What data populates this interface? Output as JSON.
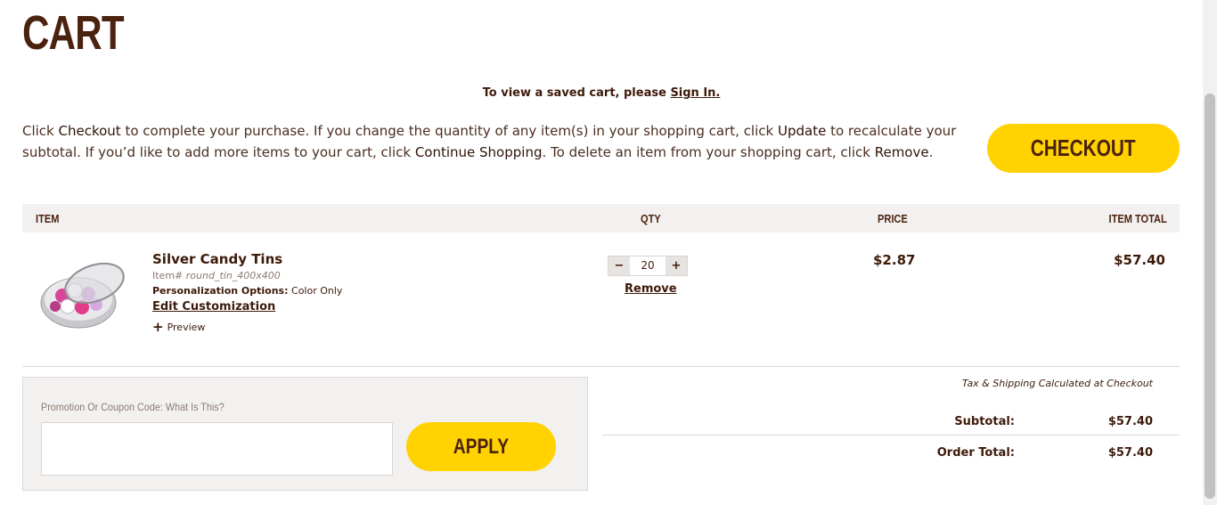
{
  "page": {
    "title": "CART"
  },
  "saved_cart": {
    "prefix": "To view a saved cart, please ",
    "link": "Sign In."
  },
  "instructions": {
    "t1": "Click ",
    "k1": "Checkout",
    "t2": " to complete your purchase. If you change the quantity of any item(s) in your shopping cart, click ",
    "k2": "Update",
    "t3": " to recalculate your subtotal. If you’d like to add more items to your cart, click ",
    "k3": "Continue Shopping",
    "t4": ". To delete an item from your shopping cart, click ",
    "k4": "Remove",
    "t5": "."
  },
  "checkout_button": "CHECKOUT",
  "table": {
    "headers": {
      "item": "ITEM",
      "qty": "QTY",
      "price": "PRICE",
      "total": "ITEM TOTAL"
    }
  },
  "item": {
    "name": "Silver Candy Tins",
    "sku_label": "Item# ",
    "sku": "round_tin_400x400",
    "options_label": "Personalization Options:",
    "options_value": " Color Only",
    "edit_link": "Edit Customization",
    "preview_plus": "+",
    "preview_label": "Preview",
    "qty_minus": "−",
    "qty_plus": "+",
    "qty": "20",
    "remove": "Remove",
    "price": "$2.87",
    "total": "$57.40"
  },
  "promo": {
    "label": "Promotion Or Coupon Code: What Is This?",
    "value": "",
    "apply": "APPLY"
  },
  "summary": {
    "tax_note": "Tax & Shipping Calculated at Checkout",
    "subtotal_label": "Subtotal:",
    "subtotal_value": "$57.40",
    "order_label": "Order Total:",
    "order_value": "$57.40"
  },
  "colors": {
    "brand_yellow": "#ffd200",
    "brand_brown": "#4b2210",
    "header_bg": "#f3f1f0"
  },
  "icons": {
    "product_image": "silver-candy-tin-image",
    "plus": "plus-icon",
    "minus": "minus-icon"
  }
}
